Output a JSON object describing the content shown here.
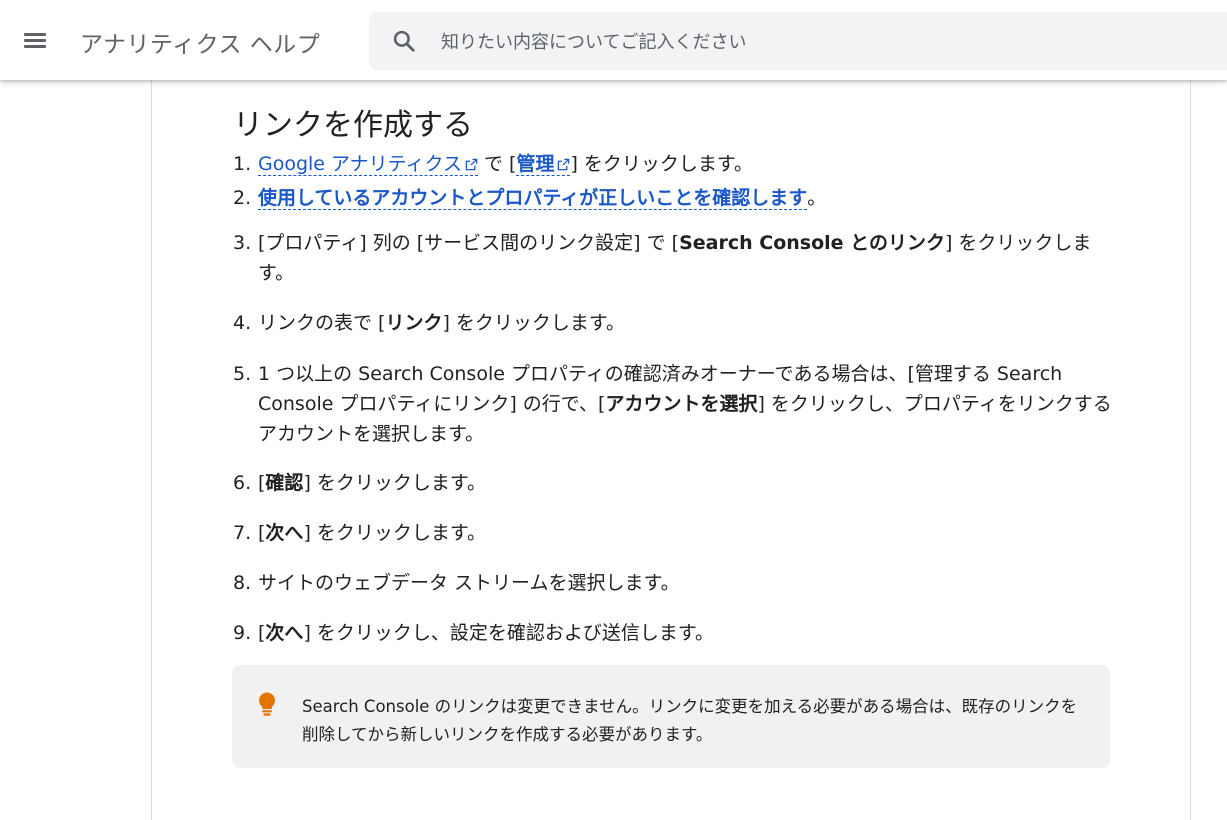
{
  "header": {
    "app_title": "アナリティクス ヘルプ",
    "search_placeholder": "知りたい内容についてご記入ください",
    "icons": {
      "menu": "hamburger-menu-icon",
      "search": "search-icon"
    }
  },
  "article": {
    "section_title": "リンクを作成する",
    "steps": [
      {
        "num": "1.",
        "link1": "Google アナリティクス",
        "mid": " で [",
        "link2": "管理",
        "end": "] をクリックします。"
      },
      {
        "num": "2.",
        "link": "使用しているアカウントとプロパティが正しいことを確認します",
        "end": "。"
      },
      {
        "num": "3.",
        "pre": "[プロパティ] 列の [サービス間のリンク設定] で [",
        "bold": "Search Console とのリンク",
        "post": "] をクリックします。"
      },
      {
        "num": "4.",
        "pre": "リンクの表で [",
        "bold": "リンク",
        "post": "] をクリックします。"
      },
      {
        "num": "5.",
        "pre": "1 つ以上の Search Console プロパティの確認済みオーナーである場合は、[管理する Search Console プロパティにリンク] の行で、[",
        "bold": "アカウントを選択",
        "post": "] をクリックし、プロパティをリンクするアカウントを選択します。"
      },
      {
        "num": "6.",
        "pre": "[",
        "bold": "確認",
        "post": "] をクリックします。"
      },
      {
        "num": "7.",
        "pre": "[",
        "bold": "次へ",
        "post": "] をクリックします。"
      },
      {
        "num": "8.",
        "text": "サイトのウェブデータ ストリームを選択します。"
      },
      {
        "num": "9.",
        "pre": "[",
        "bold": "次へ",
        "post": "] をクリックし、設定を確認および送信します。"
      }
    ],
    "note": {
      "icon": "lightbulb-icon",
      "icon_color": "#e37400",
      "text": "Search Console のリンクは変更できません。リンクに変更を加える必要がある場合は、既存のリンクを削除してから新しいリンクを作成する必要があります。"
    }
  },
  "colors": {
    "link": "#1a57c8",
    "note_bg": "#f1f1f1",
    "search_bg": "#f1f3f4"
  }
}
